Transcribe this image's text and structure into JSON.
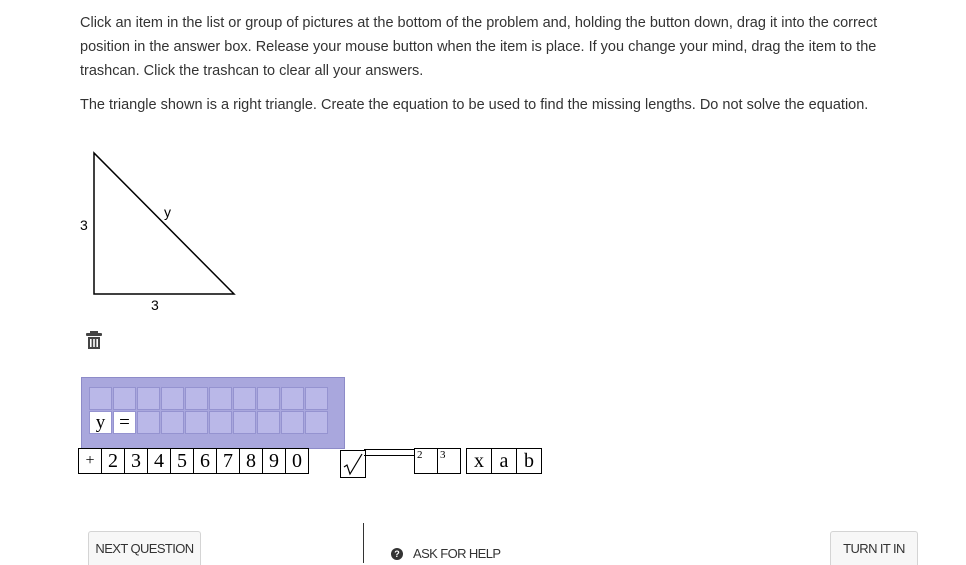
{
  "instructions": "Click an item in the list or group of pictures at the bottom of the problem and, holding the button down, drag it into the correct position in the answer box. Release your mouse button when the item is place. If you change your mind, drag the item to the trashcan. Click the trashcan to clear all your answers.",
  "question": "The triangle shown is a right triangle. Create the equation to be used to find the missing lengths. Do not solve the equation.",
  "triangle": {
    "side_vertical": "3",
    "side_horizontal": "3",
    "hypotenuse": "y"
  },
  "trash_icon": "trash-icon",
  "answer": {
    "cell_1": "y",
    "cell_2": "="
  },
  "palette": {
    "plus": "+",
    "n2": "2",
    "n3": "3",
    "n4": "4",
    "n5": "5",
    "n6": "6",
    "n7": "7",
    "n8": "8",
    "n9": "9",
    "n0": "0",
    "sqrt": "√",
    "exp2": "2",
    "exp3": "3",
    "x": "x",
    "a": "a",
    "b": "b"
  },
  "footer": {
    "next_question": "NEXT QUESTION",
    "ask_for_help": "ASK FOR HELP",
    "help_icon_glyph": "?",
    "turn_it_in": "TURN IT IN"
  },
  "colors": {
    "answer_box": "#a9a7dd",
    "answer_cell": "#bab8e8"
  }
}
